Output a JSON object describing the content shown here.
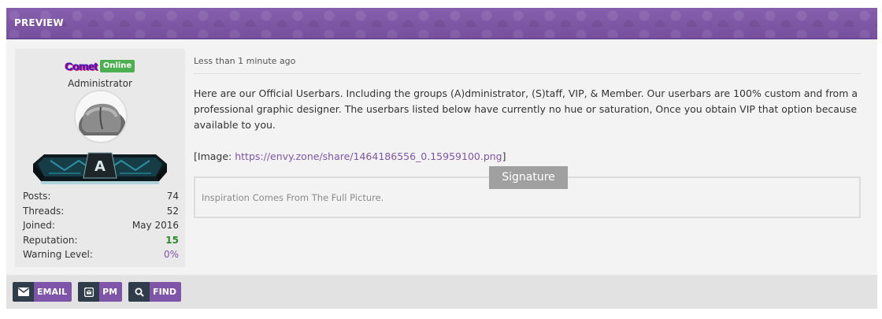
{
  "header": {
    "title": "PREVIEW"
  },
  "user": {
    "username": "Comet",
    "online_badge": "Online",
    "role": "Administrator",
    "userbar_letter": "A",
    "stats": [
      {
        "label": "Posts:",
        "value": "74"
      },
      {
        "label": "Threads:",
        "value": "52"
      },
      {
        "label": "Joined:",
        "value": "May 2016"
      },
      {
        "label": "Reputation:",
        "value": "15"
      },
      {
        "label": "Warning Level:",
        "value": "0%"
      }
    ]
  },
  "post": {
    "date": "Less than 1 minute ago",
    "paragraph1": "Here are our Official Userbars. Including the groups (A)dministrator, (S)taff, VIP, & Member. Our userbars are 100% custom and from a professional graphic designer. The userbars listed below have currently no hue or saturation, Once you obtain VIP that option because available to you.",
    "image_prefix": "[Image: ",
    "image_url": "https://envy.zone/share/1464186556_0.15959100.png",
    "image_suffix": "]"
  },
  "signature": {
    "label": "Signature",
    "text": "Inspiration Comes From The Full Picture."
  },
  "footer": {
    "buttons": [
      {
        "label": "EMAIL",
        "icon": "envelope-icon"
      },
      {
        "label": "PM",
        "icon": "message-icon"
      },
      {
        "label": "FIND",
        "icon": "search-icon"
      }
    ]
  },
  "colors": {
    "accent": "#7e55a8",
    "icon_bg": "#2f3d4a",
    "online": "#4caf50",
    "reputation": "#2a8a2a"
  }
}
